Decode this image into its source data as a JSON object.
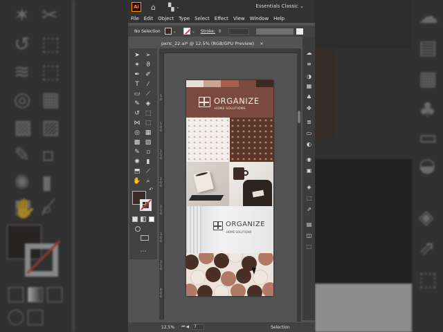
{
  "app": {
    "logo_text": "Ai",
    "workspace": "Essentials Classic"
  },
  "menu": [
    "File",
    "Edit",
    "Object",
    "Type",
    "Select",
    "Effect",
    "View",
    "Window",
    "Help"
  ],
  "control_bar": {
    "selection_status": "No Selection",
    "stroke_label": "Stroke:"
  },
  "document_tab": {
    "title": "ркпс_22.ai* @ 12,5% (RGB/GPU Preview)",
    "close": "×"
  },
  "rulers": {
    "left_marks": [
      "50",
      "100",
      "150",
      "200",
      "250",
      "300",
      "350",
      "400"
    ]
  },
  "artboard": {
    "palette_colors": [
      "#e7ddd6",
      "#c8a393",
      "#a45f4d",
      "#7d4a3c",
      "#3b2a24"
    ],
    "header_color": "#7a4a3e",
    "brand_name": "ORGANIZE",
    "brand_tagline": "HOME SOLUTIONS",
    "sign_brand_name": "ORGANIZE",
    "sign_tagline": "HOME SOLUTIONS"
  },
  "status_bar": {
    "zoom": "12,5%",
    "artboard_number": "7",
    "current_tool": "Selection"
  },
  "icons": {
    "workspace_caret": "chevron-down-icon",
    "home": "home-icon",
    "arrange": "arrange-documents-icon"
  },
  "colors": {
    "accent": "#ff9a00",
    "brand_brown": "#7a4a3e",
    "none_slash": "#e03030"
  }
}
